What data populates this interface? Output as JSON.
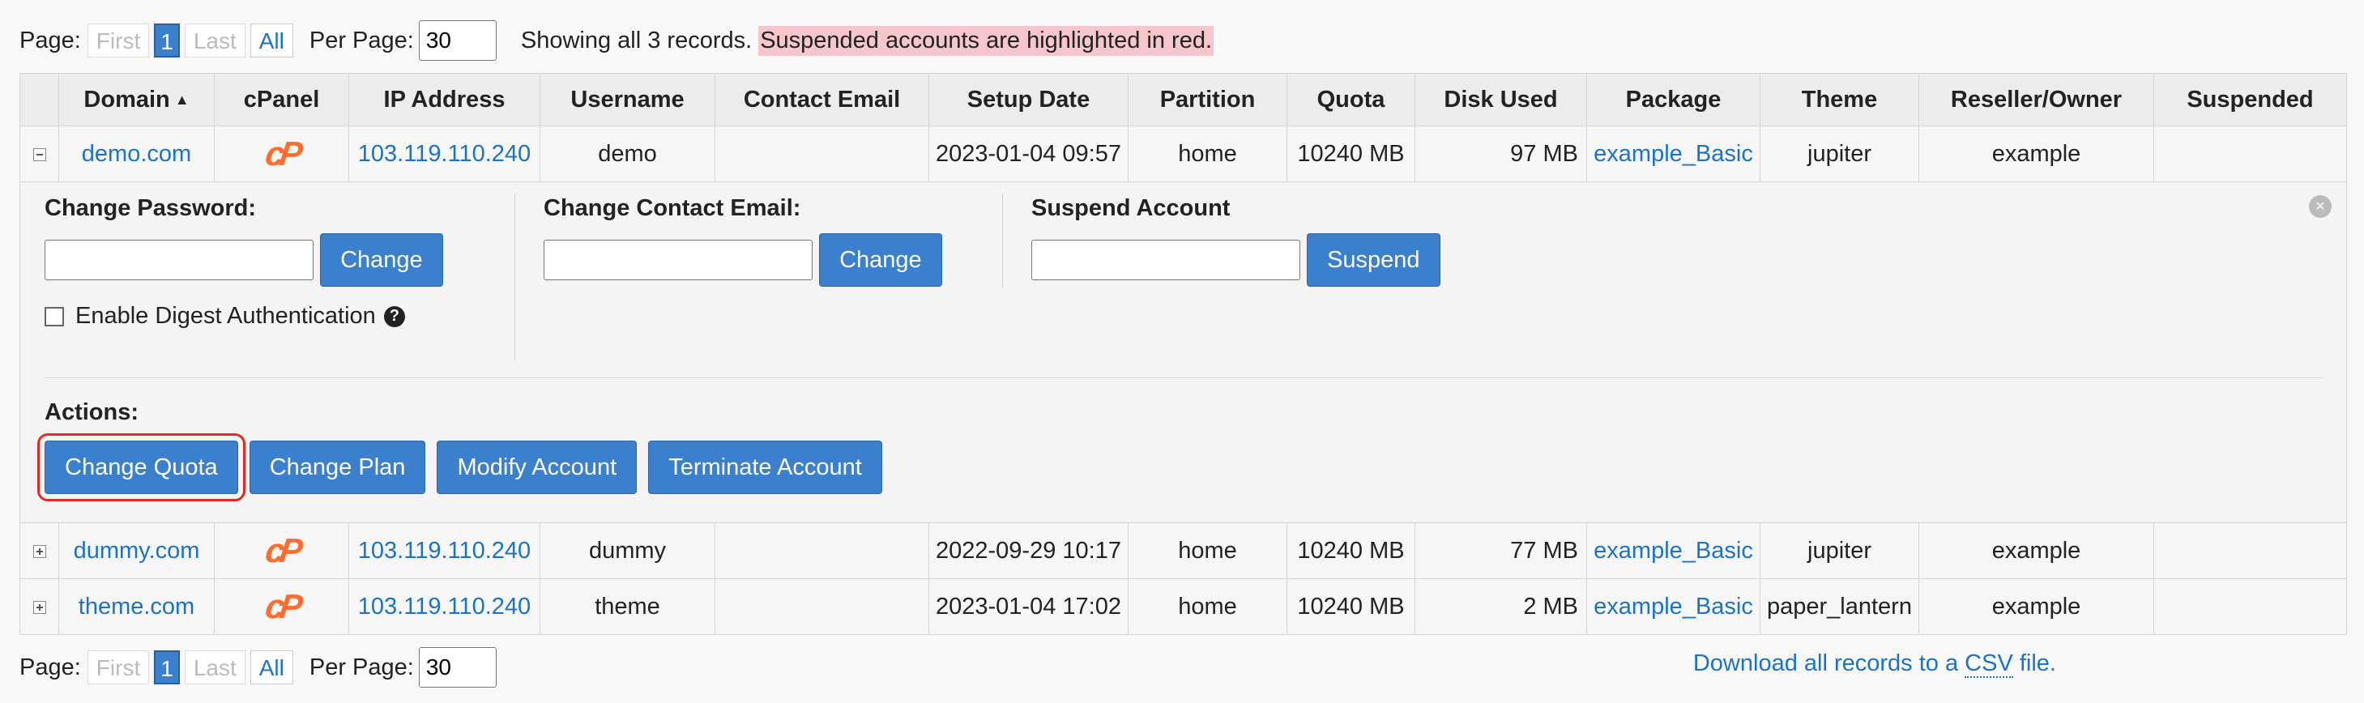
{
  "pager": {
    "page_label": "Page:",
    "first": "First",
    "current": "1",
    "last": "Last",
    "all": "All",
    "per_page_label": "Per Page:",
    "per_page_value": "30"
  },
  "showing_text": "Showing all 3 records.",
  "suspended_note": "Suspended accounts are highlighted in red.",
  "csv": {
    "before": "Download all records to a",
    "abbr": "CSV",
    "after": "file."
  },
  "columns": [
    "Domain",
    "cPanel",
    "IP Address",
    "Username",
    "Contact Email",
    "Setup Date",
    "Partition",
    "Quota",
    "Disk Used",
    "Package",
    "Theme",
    "Reseller/Owner",
    "Suspended"
  ],
  "sort_icon": "sort-ascending-icon",
  "cpanel_icon": "cpanel-logo-icon",
  "rows": [
    {
      "domain": "demo.com",
      "ip": "103.119.110.240",
      "username": "demo",
      "contact_email": "",
      "setup_date": "2023-01-04 09:57",
      "partition": "home",
      "quota": "10240 MB",
      "disk_used": "97 MB",
      "package": "example_Basic",
      "theme": "jupiter",
      "owner": "example",
      "suspended": ""
    },
    {
      "domain": "dummy.com",
      "ip": "103.119.110.240",
      "username": "dummy",
      "contact_email": "",
      "setup_date": "2022-09-29 10:17",
      "partition": "home",
      "quota": "10240 MB",
      "disk_used": "77 MB",
      "package": "example_Basic",
      "theme": "jupiter",
      "owner": "example",
      "suspended": ""
    },
    {
      "domain": "theme.com",
      "ip": "103.119.110.240",
      "username": "theme",
      "contact_email": "",
      "setup_date": "2023-01-04 17:02",
      "partition": "home",
      "quota": "10240 MB",
      "disk_used": "2 MB",
      "package": "example_Basic",
      "theme": "paper_lantern",
      "owner": "example",
      "suspended": ""
    }
  ],
  "detail": {
    "change_password": {
      "label": "Change Password:",
      "button": "Change"
    },
    "digest_auth_label": "Enable Digest Authentication",
    "help_icon": "?",
    "change_email": {
      "label": "Change Contact Email:",
      "button": "Change"
    },
    "suspend": {
      "label": "Suspend Account",
      "button": "Suspend"
    },
    "actions_label": "Actions:",
    "actions": [
      "Change Quota",
      "Change Plan",
      "Modify Account",
      "Terminate Account"
    ],
    "close_icon": "×"
  },
  "colors": {
    "accent": "#3b80cc",
    "link": "#1b73c7",
    "highlight_red": "#e02a2a",
    "suspended_bg": "#f5c7cc",
    "cpanel_orange": "#ff6c2c"
  }
}
